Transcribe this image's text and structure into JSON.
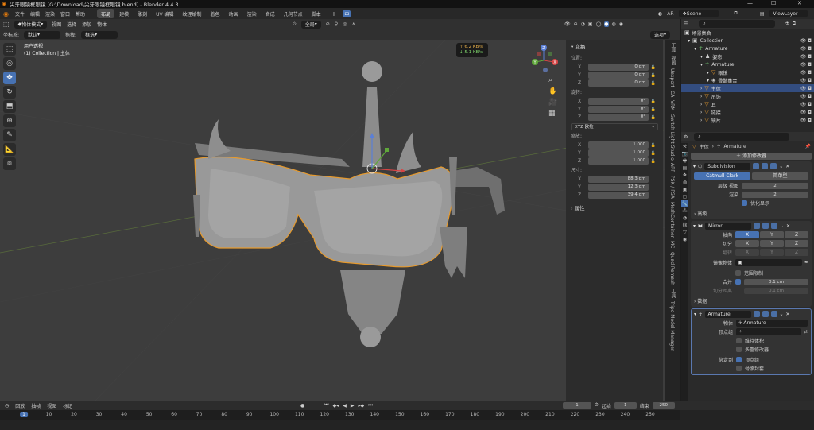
{
  "titlebar": {
    "title": "尖牙眼镜框眼镜 [G:\\Download\\尖牙眼镜框眼镜.blend] - Blender 4.4.3",
    "minimize": "—",
    "maximize": "☐",
    "close": "✕"
  },
  "topbar": {
    "menus": [
      "文件",
      "编辑",
      "渲染",
      "窗口",
      "帮助"
    ],
    "workspaces": [
      "布局",
      "建模",
      "雕刻",
      "UV 编辑",
      "纹理绘制",
      "着色",
      "动画",
      "渲染",
      "合成",
      "几何节点",
      "脚本"
    ],
    "active_workspace": "布局",
    "add_tab": "+",
    "ime": "中",
    "scene_ar": "AR",
    "scene": "Scene",
    "view_layer": "ViewLayer"
  },
  "viewport_header": {
    "mode": "物体模式",
    "menus": [
      "视图",
      "选择",
      "添加",
      "物体"
    ],
    "transform_global": "全局",
    "options": "选项",
    "coord_label": "坐标系:",
    "coord_value": "默认",
    "drag_label": "拖拽:",
    "drag_value": "框选"
  },
  "viewport": {
    "view_name": "用户透视",
    "collection_line": "(1) Collection | 主体",
    "net_up": "↑ 6.2 KB/s",
    "net_down": "↓ 5.1 KB/s",
    "gizmo_x": "X",
    "gizmo_y": "Y",
    "gizmo_z": "Z"
  },
  "tools": [
    "select-box",
    "cursor",
    "move",
    "rotate",
    "scale",
    "transform",
    "annotate",
    "measure",
    "add-cube"
  ],
  "npanel": {
    "section": "变换",
    "location_label": "位置:",
    "location": [
      {
        "axis": "X",
        "value": "0 cm"
      },
      {
        "axis": "Y",
        "value": "0 cm"
      },
      {
        "axis": "Z",
        "value": "0 cm"
      }
    ],
    "rotation_label": "旋转:",
    "rotation": [
      {
        "axis": "X",
        "value": "0°"
      },
      {
        "axis": "Y",
        "value": "0°"
      },
      {
        "axis": "Z",
        "value": "0°"
      }
    ],
    "rotation_mode": "XYZ 欧拉",
    "scale_label": "缩放:",
    "scale": [
      {
        "axis": "X",
        "value": "1.000"
      },
      {
        "axis": "Y",
        "value": "1.000"
      },
      {
        "axis": "Z",
        "value": "1.000"
      }
    ],
    "dims_label": "尺寸:",
    "dims": [
      {
        "axis": "X",
        "value": "88.3 cm"
      },
      {
        "axis": "Y",
        "value": "12.3 cm"
      },
      {
        "axis": "Z",
        "value": "39.4 cm"
      }
    ],
    "properties": "属性"
  },
  "npanel_tabs": [
    "Tripo Model Manager",
    "工具",
    "Quad Remesh",
    "MC",
    "MeshContainer",
    "PSK / PSA",
    "ARP",
    "Switch Light Studio",
    "VRM",
    "CA",
    "Uexport",
    "视图",
    "工具"
  ],
  "outliner": {
    "title": "场景集合",
    "rows": [
      {
        "label": "Collection",
        "indent": 0,
        "icon": "▣",
        "selected": false
      },
      {
        "label": "Armature",
        "indent": 1,
        "icon": "☥",
        "selected": false
      },
      {
        "label": "姿态",
        "indent": 2,
        "icon": "♟",
        "selected": false
      },
      {
        "label": "Armature",
        "indent": 2,
        "icon": "☥",
        "selected": false
      },
      {
        "label": "眼镜",
        "indent": 3,
        "icon": "▽",
        "selected": false
      },
      {
        "label": "骨骼集合",
        "indent": 3,
        "icon": "◈",
        "selected": false
      },
      {
        "label": "主体",
        "indent": 2,
        "icon": "▽",
        "selected": true
      },
      {
        "label": "吊饰",
        "indent": 2,
        "icon": "▽",
        "selected": false
      },
      {
        "label": "耳",
        "indent": 2,
        "icon": "▽",
        "selected": false
      },
      {
        "label": "链接",
        "indent": 2,
        "icon": "▽",
        "selected": false
      },
      {
        "label": "镜片",
        "indent": 2,
        "icon": "▽",
        "selected": false
      }
    ]
  },
  "properties": {
    "breadcrumb_obj": "主体",
    "breadcrumb_mod": "Armature",
    "add_modifier": "添加修改器",
    "subdivision": {
      "name": "Subdivision",
      "mode_a": "Catmull-Clark",
      "mode_b": "简单型",
      "levels_view_label": "层级 视图",
      "levels_view": "2",
      "render_label": "渲染",
      "render": "2",
      "optimal": "优化显示",
      "advanced": "高级"
    },
    "mirror": {
      "name": "Mirror",
      "axis_label": "轴向",
      "bisect_label": "切分",
      "flip_label": "翻转",
      "axes": [
        "X",
        "Y",
        "Z"
      ],
      "mirror_obj_label": "镜像物体",
      "clipping": "范围限制",
      "merge_label": "合并",
      "merge_value": "0.1 cm",
      "bisect_dist_label": "切分距离",
      "bisect_dist_value": "0.1 cm",
      "data": "数据"
    },
    "armature": {
      "name": "Armature",
      "object_label": "物体",
      "object_value": "Armature",
      "vgroup_label": "顶点组",
      "preserve_volume": "维持体积",
      "multi_modifier": "多重修改器",
      "bind_to_label": "绑定到",
      "vertex_groups": "顶点组",
      "bone_envelopes": "骨骼封套"
    }
  },
  "timeline": {
    "menus": [
      "回放",
      "抽帧",
      "视图",
      "标记"
    ],
    "current_frame": "1",
    "start_label": "起始",
    "start": "1",
    "end_label": "结束",
    "end": "250",
    "ticks": [
      "1",
      "10",
      "20",
      "30",
      "40",
      "50",
      "60",
      "70",
      "80",
      "90",
      "100",
      "110",
      "120",
      "130",
      "140",
      "150",
      "160",
      "170",
      "180",
      "190",
      "200",
      "210",
      "220",
      "230",
      "240",
      "250"
    ]
  }
}
